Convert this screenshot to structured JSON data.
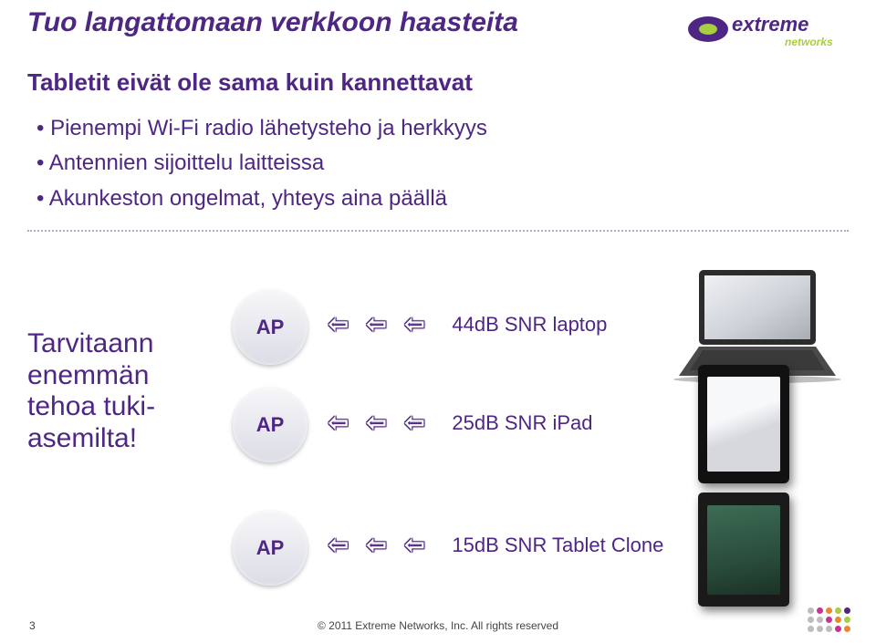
{
  "brand": {
    "name": "extreme",
    "sub": "networks"
  },
  "title": "Tuo langattomaan verkkoon haasteita",
  "subtitle": "Tabletit eivät ole sama kuin kannettavat",
  "bullets": [
    "Pienempi Wi-Fi radio lähetysteho ja herkkyys",
    "Antennien sijoittelu laitteissa",
    "Akunkeston ongelmat, yhteys aina päällä"
  ],
  "side_text": "Tarvitaann enemmän tehoa tuki-asemilta!",
  "rows": [
    {
      "ap": "AP",
      "snr": "44dB SNR laptop"
    },
    {
      "ap": "AP",
      "snr": "25dB SNR iPad"
    },
    {
      "ap": "AP",
      "snr": "15dB SNR Tablet Clone"
    }
  ],
  "arrow_glyph": "⇦",
  "footer": {
    "page": "3",
    "copyright": "© 2011 Extreme Networks, Inc. All rights reserved"
  },
  "colors": {
    "purple": "#4e2683",
    "lime": "#a8cf3f",
    "orange": "#e88a2a",
    "magenta": "#c9338f",
    "grey": "#bdbdbd"
  }
}
